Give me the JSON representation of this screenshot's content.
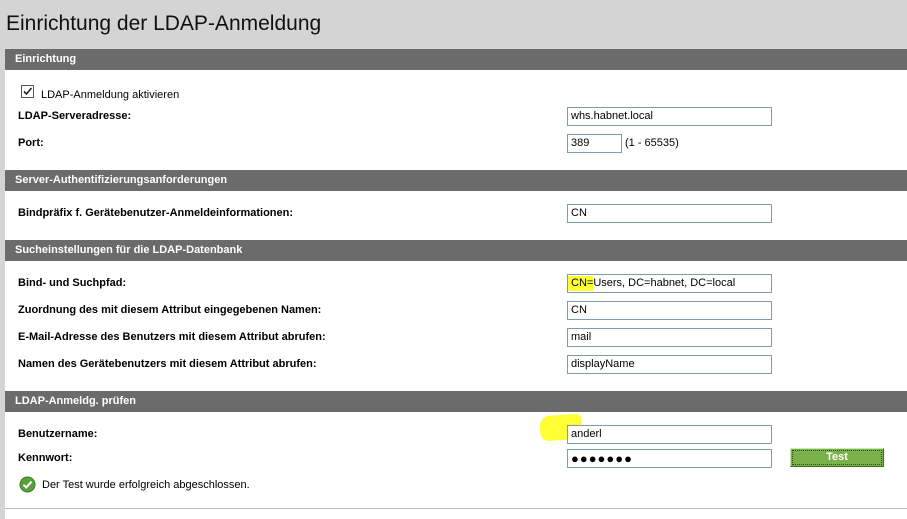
{
  "page": {
    "title": "Einrichtung der LDAP-Anmeldung"
  },
  "sections": {
    "setup": {
      "header": "Einrichtung",
      "enable_checkbox": {
        "label": "LDAP-Anmeldung aktivieren",
        "checked": true
      },
      "server_address": {
        "label": "LDAP-Serveradresse:",
        "value": "whs.habnet.local"
      },
      "port": {
        "label": "Port:",
        "value": "389",
        "range_hint": "(1 - 65535)"
      }
    },
    "auth": {
      "header": "Server-Authentifizierungsanforderungen",
      "bind_prefix": {
        "label": "Bindpräfix f. Gerätebenutzer-Anmeldeinformationen:",
        "value": "CN"
      }
    },
    "search": {
      "header": "Sucheinstellungen für die LDAP-Datenbank",
      "bind_search_path": {
        "label": "Bind- und Suchpfad:",
        "value_highlight": "CN=",
        "value_rest": "Users, DC=habnet, DC=local"
      },
      "name_mapping": {
        "label": "Zuordnung des mit diesem Attribut eingegebenen Namen:",
        "value": "CN"
      },
      "email_attribute": {
        "label": "E-Mail-Adresse des Benutzers mit diesem Attribut abrufen:",
        "value": "mail"
      },
      "display_name_attribute": {
        "label": "Namen des Gerätebenutzers mit diesem Attribut abrufen:",
        "value": "displayName"
      }
    },
    "test": {
      "header": "LDAP-Anmeldg. prüfen",
      "username": {
        "label": "Benutzername:",
        "value": "anderl"
      },
      "password": {
        "label": "Kennwort:",
        "value": "●●●●●●●"
      },
      "test_button": "Test",
      "result_message": "Der Test wurde erfolgreich abgeschlossen."
    }
  },
  "colors": {
    "section_header_bg": "#6b6b6b",
    "highlight": "#ffff36",
    "test_button_bg": "#79b14a",
    "success_icon": "#5aa13a"
  },
  "icons": {
    "checkbox": "checkmark-icon",
    "success": "success-check-icon"
  }
}
